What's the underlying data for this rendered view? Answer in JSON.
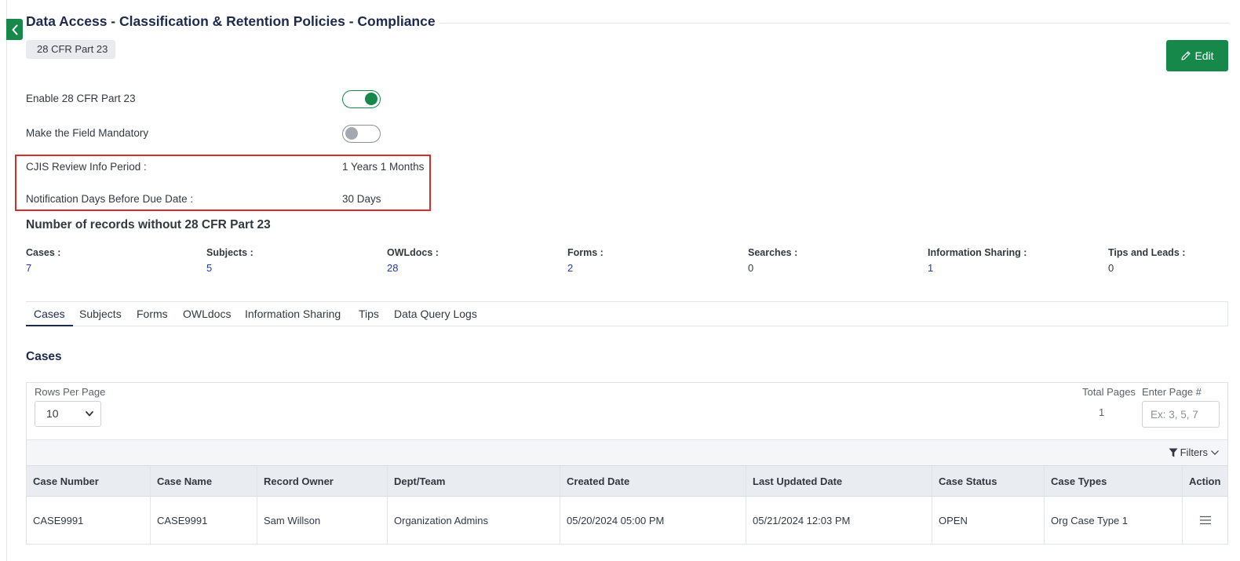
{
  "page": {
    "title": "Data Access - Classification & Retention Policies - Compliance"
  },
  "policy": {
    "chip": "28 CFR Part 23"
  },
  "toolbar": {
    "edit_label": "Edit"
  },
  "settings": {
    "enable_label": "Enable 28 CFR Part 23",
    "enable_on": true,
    "mandatory_label": "Make the Field Mandatory",
    "mandatory_on": false,
    "review_period_label": "CJIS Review Info Period :",
    "review_period_value": "1 Years 1 Months",
    "notification_label": "Notification Days Before Due Date :",
    "notification_value": "30 Days"
  },
  "records": {
    "heading": "Number of records without 28 CFR Part 23",
    "stats": [
      {
        "label": "Cases :",
        "value": "7"
      },
      {
        "label": "Subjects :",
        "value": "5"
      },
      {
        "label": "OWLdocs :",
        "value": "28"
      },
      {
        "label": "Forms :",
        "value": "2"
      },
      {
        "label": "Searches :",
        "value": "0"
      },
      {
        "label": "Information Sharing :",
        "value": "1"
      },
      {
        "label": "Tips and Leads :",
        "value": "0"
      }
    ]
  },
  "tabs": [
    "Cases",
    "Subjects",
    "Forms",
    "OWLdocs",
    "Information Sharing",
    "Tips",
    "Data Query Logs"
  ],
  "active_tab": "Cases",
  "cases": {
    "heading": "Cases",
    "rows_per_page_label": "Rows Per Page",
    "rows_per_page_value": "10",
    "total_pages_label": "Total Pages",
    "total_pages_value": "1",
    "enter_page_label": "Enter Page #",
    "enter_page_placeholder": "Ex: 3, 5, 7",
    "filters_label": "Filters",
    "columns": [
      "Case Number",
      "Case Name",
      "Record Owner",
      "Dept/Team",
      "Created Date",
      "Last Updated Date",
      "Case Status",
      "Case Types",
      "Action"
    ],
    "rows": [
      [
        "CASE9991",
        "CASE9991",
        "Sam Willson",
        "Organization Admins",
        "05/20/2024 05:00 PM",
        "05/21/2024 12:03 PM",
        "OPEN",
        "Org Case Type 1",
        ""
      ]
    ]
  },
  "colors": {
    "brand_green": "#16894a",
    "highlight_red": "#d92c2c",
    "title_navy": "#1c2a4d",
    "link_blue": "#1f3a9a"
  }
}
